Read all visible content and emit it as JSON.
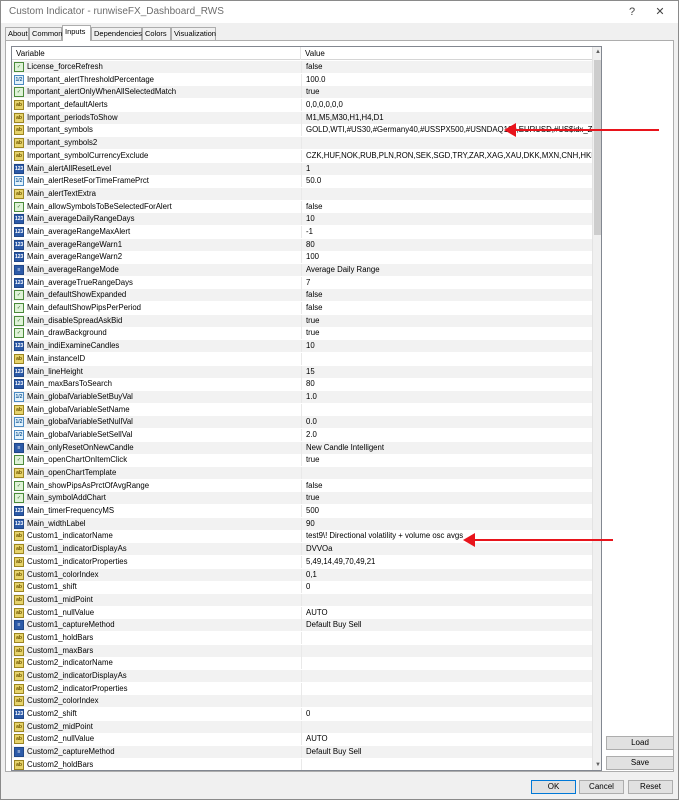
{
  "window": {
    "title": "Custom Indicator - runwiseFX_Dashboard_RWS",
    "help": "?",
    "close": "✕"
  },
  "tabs": [
    "About",
    "Common",
    "Inputs",
    "Dependencies",
    "Colors",
    "Visualization"
  ],
  "grid": {
    "headers": {
      "variable": "Variable",
      "value": "Value"
    },
    "rows": [
      {
        "type": "bool",
        "name": "License_forceRefresh",
        "value": "false"
      },
      {
        "type": "dbl",
        "name": "Important_alertThresholdPercentage",
        "value": "100.0"
      },
      {
        "type": "bool",
        "name": "Important_alertOnlyWhenAllSelectedMatch",
        "value": "true"
      },
      {
        "type": "str",
        "name": "Important_defaultAlerts",
        "value": "0,0,0,0,0,0"
      },
      {
        "type": "str",
        "name": "Important_periodsToShow",
        "value": "M1,M5,M30,H1,H4,D1"
      },
      {
        "type": "str",
        "name": "Important_symbols",
        "value": "GOLD,WTI,#US30,#Germany40,#USSPX500,#USNDAQ100,EURUSD,#US$idx_Z23"
      },
      {
        "type": "str",
        "name": "Important_symbols2",
        "value": ""
      },
      {
        "type": "str",
        "name": "Important_symbolCurrencyExclude",
        "value": "CZK,HUF,NOK,RUB,PLN,RON,SEK,SGD,TRY,ZAR,XAG,XAU,DKK,MXN,CNH,HKD"
      },
      {
        "type": "int",
        "name": "Main_alertAllResetLevel",
        "value": "1"
      },
      {
        "type": "dbl",
        "name": "Main_alertResetForTimeFramePrct",
        "value": "50.0"
      },
      {
        "type": "str",
        "name": "Main_alertTextExtra",
        "value": ""
      },
      {
        "type": "bool",
        "name": "Main_allowSymbolsToBeSelectedForAlert",
        "value": "false"
      },
      {
        "type": "int",
        "name": "Main_averageDailyRangeDays",
        "value": "10"
      },
      {
        "type": "int",
        "name": "Main_averageRangeMaxAlert",
        "value": "-1"
      },
      {
        "type": "int",
        "name": "Main_averageRangeWarn1",
        "value": "80"
      },
      {
        "type": "int",
        "name": "Main_averageRangeWarn2",
        "value": "100"
      },
      {
        "type": "enum",
        "name": "Main_averageRangeMode",
        "value": "Average Daily Range"
      },
      {
        "type": "int",
        "name": "Main_averageTrueRangeDays",
        "value": "7"
      },
      {
        "type": "bool",
        "name": "Main_defaultShowExpanded",
        "value": "false"
      },
      {
        "type": "bool",
        "name": "Main_defaultShowPipsPerPeriod",
        "value": "false"
      },
      {
        "type": "bool",
        "name": "Main_disableSpreadAskBid",
        "value": "true"
      },
      {
        "type": "bool",
        "name": "Main_drawBackground",
        "value": "true"
      },
      {
        "type": "int",
        "name": "Main_indiExamineCandles",
        "value": "10"
      },
      {
        "type": "str",
        "name": "Main_instanceID",
        "value": ""
      },
      {
        "type": "int",
        "name": "Main_lineHeight",
        "value": "15"
      },
      {
        "type": "int",
        "name": "Main_maxBarsToSearch",
        "value": "80"
      },
      {
        "type": "dbl",
        "name": "Main_globalVariableSetBuyVal",
        "value": "1.0"
      },
      {
        "type": "str",
        "name": "Main_globalVariableSetName",
        "value": ""
      },
      {
        "type": "dbl",
        "name": "Main_globalVariableSetNullVal",
        "value": "0.0"
      },
      {
        "type": "dbl",
        "name": "Main_globalVariableSetSellVal",
        "value": "2.0"
      },
      {
        "type": "enum",
        "name": "Main_onlyResetOnNewCandle",
        "value": "New Candle Intelligent"
      },
      {
        "type": "bool",
        "name": "Main_openChartOnItemClick",
        "value": "true"
      },
      {
        "type": "str",
        "name": "Main_openChartTemplate",
        "value": ""
      },
      {
        "type": "bool",
        "name": "Main_showPipsAsPrctOfAvgRange",
        "value": "false"
      },
      {
        "type": "bool",
        "name": "Main_symbolAddChart",
        "value": "true"
      },
      {
        "type": "int",
        "name": "Main_timerFrequencyMS",
        "value": "500"
      },
      {
        "type": "int",
        "name": "Main_widthLabel",
        "value": "90"
      },
      {
        "type": "str",
        "name": "Custom1_indicatorName",
        "value": "test9\\! Directional volatility + volume osc avgs"
      },
      {
        "type": "str",
        "name": "Custom1_indicatorDisplayAs",
        "value": "DVVOa"
      },
      {
        "type": "str",
        "name": "Custom1_indicatorProperties",
        "value": "5,49,14,49,70,49,21"
      },
      {
        "type": "str",
        "name": "Custom1_colorIndex",
        "value": "0,1"
      },
      {
        "type": "str",
        "name": "Custom1_shift",
        "value": "0"
      },
      {
        "type": "str",
        "name": "Custom1_midPoint",
        "value": ""
      },
      {
        "type": "str",
        "name": "Custom1_nullValue",
        "value": "AUTO"
      },
      {
        "type": "enum",
        "name": "Custom1_captureMethod",
        "value": "Default Buy Sell"
      },
      {
        "type": "str",
        "name": "Custom1_holdBars",
        "value": ""
      },
      {
        "type": "str",
        "name": "Custom1_maxBars",
        "value": ""
      },
      {
        "type": "str",
        "name": "Custom2_indicatorName",
        "value": ""
      },
      {
        "type": "str",
        "name": "Custom2_indicatorDisplayAs",
        "value": ""
      },
      {
        "type": "str",
        "name": "Custom2_indicatorProperties",
        "value": ""
      },
      {
        "type": "str",
        "name": "Custom2_colorIndex",
        "value": ""
      },
      {
        "type": "int",
        "name": "Custom2_shift",
        "value": "0"
      },
      {
        "type": "str",
        "name": "Custom2_midPoint",
        "value": ""
      },
      {
        "type": "str",
        "name": "Custom2_nullValue",
        "value": "AUTO"
      },
      {
        "type": "enum",
        "name": "Custom2_captureMethod",
        "value": "Default Buy Sell"
      },
      {
        "type": "str",
        "name": "Custom2_holdBars",
        "value": ""
      }
    ]
  },
  "type_icons": {
    "bool": "✓",
    "int": "123",
    "dbl": "1/2",
    "str": "ab",
    "enum": "≡"
  },
  "buttons": {
    "load": "Load",
    "save": "Save",
    "ok": "OK",
    "cancel": "Cancel",
    "reset": "Reset"
  },
  "colors": {
    "annotation_arrow": "#e8141c",
    "ok_border": "#0078d7"
  }
}
